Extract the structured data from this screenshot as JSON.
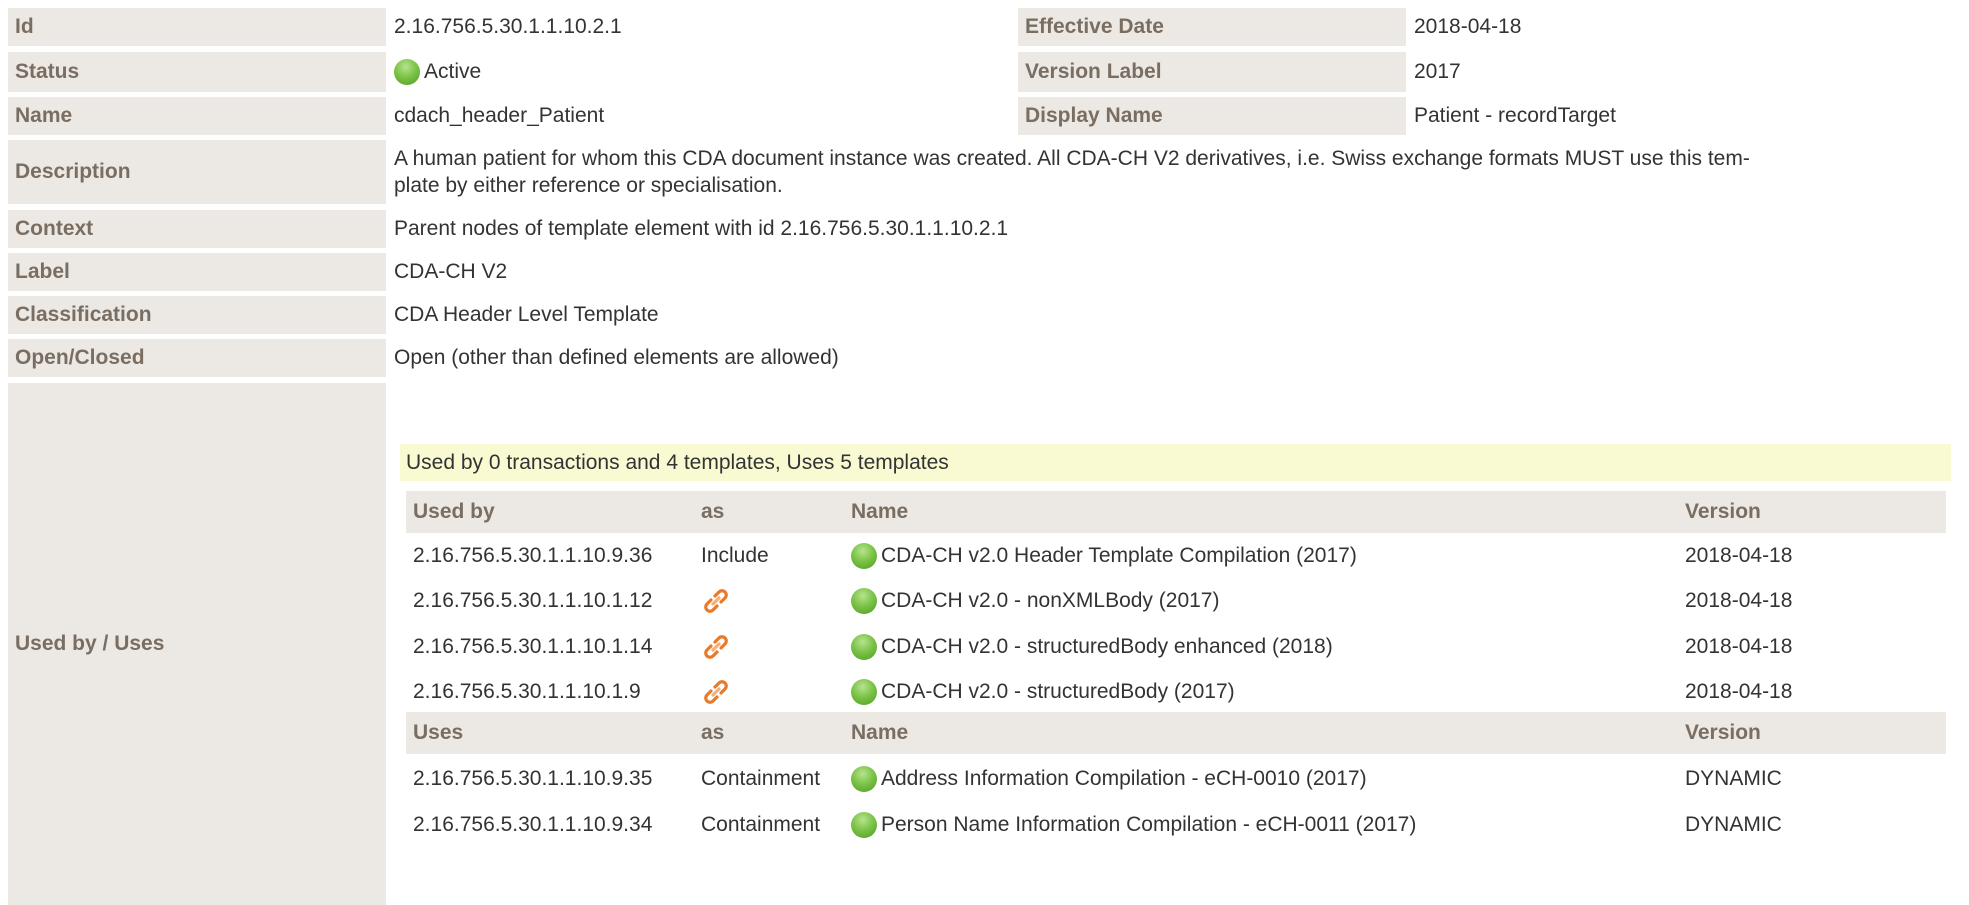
{
  "fields": {
    "id": {
      "label": "Id",
      "value": "2.16.756.5.30.1.1.10.2.1"
    },
    "effective_date": {
      "label": "Effective Date",
      "value": "2018-04-18"
    },
    "status": {
      "label": "Status",
      "value": "Active"
    },
    "version_label": {
      "label": "Version Label",
      "value": "2017"
    },
    "name": {
      "label": "Name",
      "value": "cdach_header_Patient"
    },
    "display_name": {
      "label": "Display Name",
      "value": "Patient - recordTarget"
    },
    "description": {
      "label": "Description",
      "value_line1": "A human patient for whom this CDA document instance was created. All CDA-CH V2 derivatives, i.e. Swiss exchange formats MUST use this tem-",
      "value_line2": "plate by either reference or specialisation."
    },
    "context": {
      "label": "Context",
      "value": "Parent nodes of template element with id 2.16.756.5.30.1.1.10.2.1"
    },
    "label": {
      "label": "Label",
      "value": "CDA-CH V2"
    },
    "classification": {
      "label": "Classification",
      "value": "CDA Header Level Template"
    },
    "open_closed": {
      "label": "Open/Closed",
      "value": "Open (other than defined elements are allowed)"
    },
    "used_by_uses": {
      "label": "Used by / Uses"
    }
  },
  "usage": {
    "summary": "Used by 0 transactions and 4 templates, Uses 5 templates",
    "used_by_header": {
      "col1": "Used by",
      "col2": "as",
      "col3": "Name",
      "col4": "Version"
    },
    "used_by": [
      {
        "id": "2.16.756.5.30.1.1.10.9.36",
        "as": "Include",
        "name": "CDA-CH v2.0 Header Template Compilation (2017)",
        "version": "2018-04-18"
      },
      {
        "id": "2.16.756.5.30.1.1.10.1.12",
        "as_icon": "link-icon",
        "name": "CDA-CH v2.0 - nonXMLBody (2017)",
        "version": "2018-04-18"
      },
      {
        "id": "2.16.756.5.30.1.1.10.1.14",
        "as_icon": "link-icon",
        "name": "CDA-CH v2.0 - structuredBody enhanced (2018)",
        "version": "2018-04-18"
      },
      {
        "id": "2.16.756.5.30.1.1.10.1.9",
        "as_icon": "link-icon",
        "name": "CDA-CH v2.0 - structuredBody (2017)",
        "version": "2018-04-18"
      }
    ],
    "uses_header": {
      "col1": "Uses",
      "col2": "as",
      "col3": "Name",
      "col4": "Version"
    },
    "uses": [
      {
        "id": "2.16.756.5.30.1.1.10.9.35",
        "as": "Containment",
        "name": "Address Information Compilation - eCH-0010 (2017)",
        "version": "DYNAMIC"
      },
      {
        "id": "2.16.756.5.30.1.1.10.9.34",
        "as": "Containment",
        "name": "Person Name Information Compilation - eCH-0011 (2017)",
        "version": "DYNAMIC"
      }
    ]
  },
  "colors": {
    "label_bg": "#ece9e4",
    "label_text": "#7a6e62",
    "banner_bg": "#fafad2",
    "status_active": "#7cc448",
    "link_icon": "#e87a2a"
  }
}
